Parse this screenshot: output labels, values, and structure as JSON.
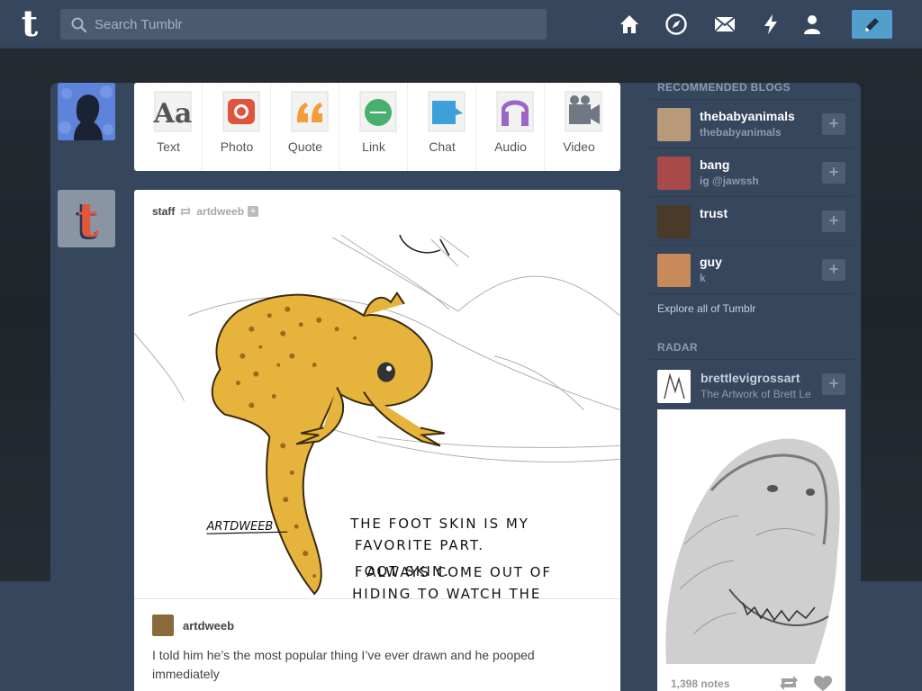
{
  "header": {
    "logo": "t",
    "search_placeholder": "Search Tumblr",
    "icons": [
      "home-icon",
      "explore-icon",
      "mail-icon",
      "activity-icon",
      "account-icon",
      "compose-icon"
    ]
  },
  "post_types": [
    {
      "label": "Text",
      "icon": "text-icon",
      "color": "#666666"
    },
    {
      "label": "Photo",
      "icon": "photo-icon",
      "color": "#e0543e"
    },
    {
      "label": "Quote",
      "icon": "quote-icon",
      "color": "#f39c3a"
    },
    {
      "label": "Link",
      "icon": "link-icon",
      "color": "#47b06d"
    },
    {
      "label": "Chat",
      "icon": "chat-icon",
      "color": "#3ea0d9"
    },
    {
      "label": "Audio",
      "icon": "audio-icon",
      "color": "#9b66c7"
    },
    {
      "label": "Video",
      "icon": "video-icon",
      "color": "#6f7883"
    }
  ],
  "post": {
    "author": "staff",
    "reblog_source": "artdweeb",
    "art_lines": [
      "THE FOOT SKIN IS MY",
      "FAVORITE PART.",
      "I ALWAYS COME OUT OF",
      "HIDING TO WATCH THE",
      "FOOT SKIN."
    ],
    "art_signature": "ARTDWEEB",
    "caption_author": "artdweeb",
    "caption_text": "I told him he’s the most popular thing I’ve ever drawn and he pooped immediately"
  },
  "sidebar": {
    "recommended_title": "RECOMMENDED BLOGS",
    "recommended": [
      {
        "name": "thebabyanimals",
        "sub": "thebabyanimals"
      },
      {
        "name": "bang",
        "sub": "ig @jawssh"
      },
      {
        "name": "trust",
        "sub": ""
      },
      {
        "name": "guy",
        "sub": "k"
      }
    ],
    "follow_symbol": "+",
    "explore_label": "Explore all of Tumblr",
    "radar_title": "RADAR",
    "radar": {
      "name": "brettlevigrossart",
      "sub": "The Artwork of Brett Le",
      "notes": "1,398 notes"
    }
  }
}
